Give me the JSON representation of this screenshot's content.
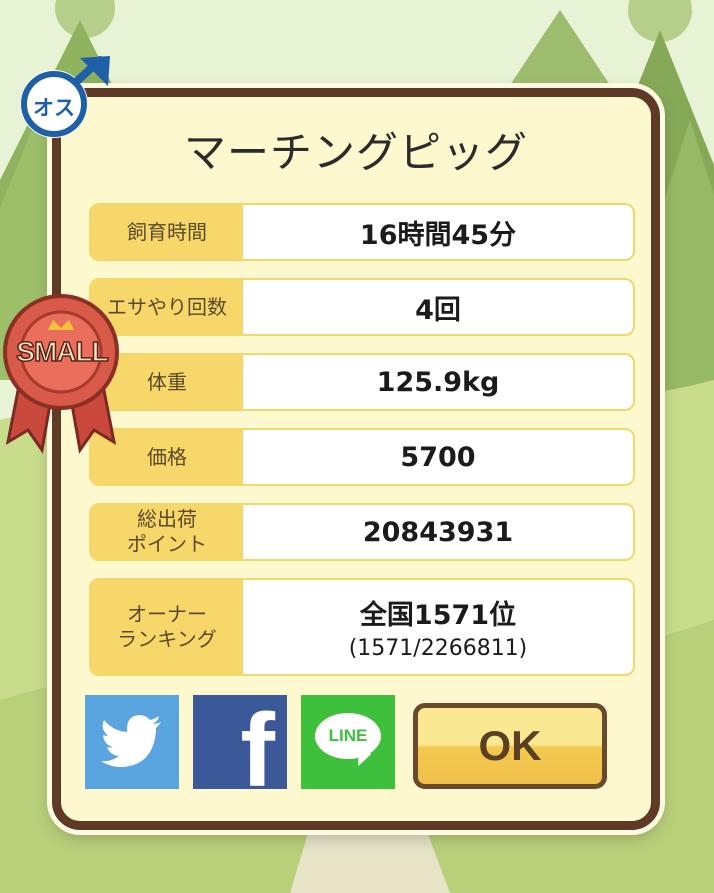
{
  "dialog": {
    "title": "マーチングピッグ",
    "rows": [
      {
        "label": "飼育時間",
        "value": "16時間45分"
      },
      {
        "label": "エサやり回数",
        "value": "4回"
      },
      {
        "label": "体重",
        "value": "125.9kg"
      },
      {
        "label": "価格",
        "value": "5700"
      },
      {
        "label": "総出荷\nポイント",
        "value": "20843931"
      },
      {
        "label": "オーナー\nランキング",
        "value": "全国1571位",
        "sub": "(1571/2266811)"
      }
    ],
    "ok_label": "OK"
  },
  "badges": {
    "gender_label": "オス",
    "size_label": "SMALL"
  },
  "social": {
    "line_label": "LINE",
    "facebook_glyph": "f"
  },
  "colors": {
    "frame": "#5e3a27",
    "panel": "#fdf8cd",
    "label_bg": "#f8d76a",
    "twitter": "#5aa5e0",
    "facebook": "#3b5998",
    "line": "#3fc03c",
    "ok_top": "#fbe892",
    "ok_bottom": "#f0c04a"
  },
  "icons": [
    "male-gender-icon",
    "ribbon-award-icon",
    "twitter-bird-icon",
    "facebook-f-icon",
    "line-speech-bubble-icon"
  ]
}
